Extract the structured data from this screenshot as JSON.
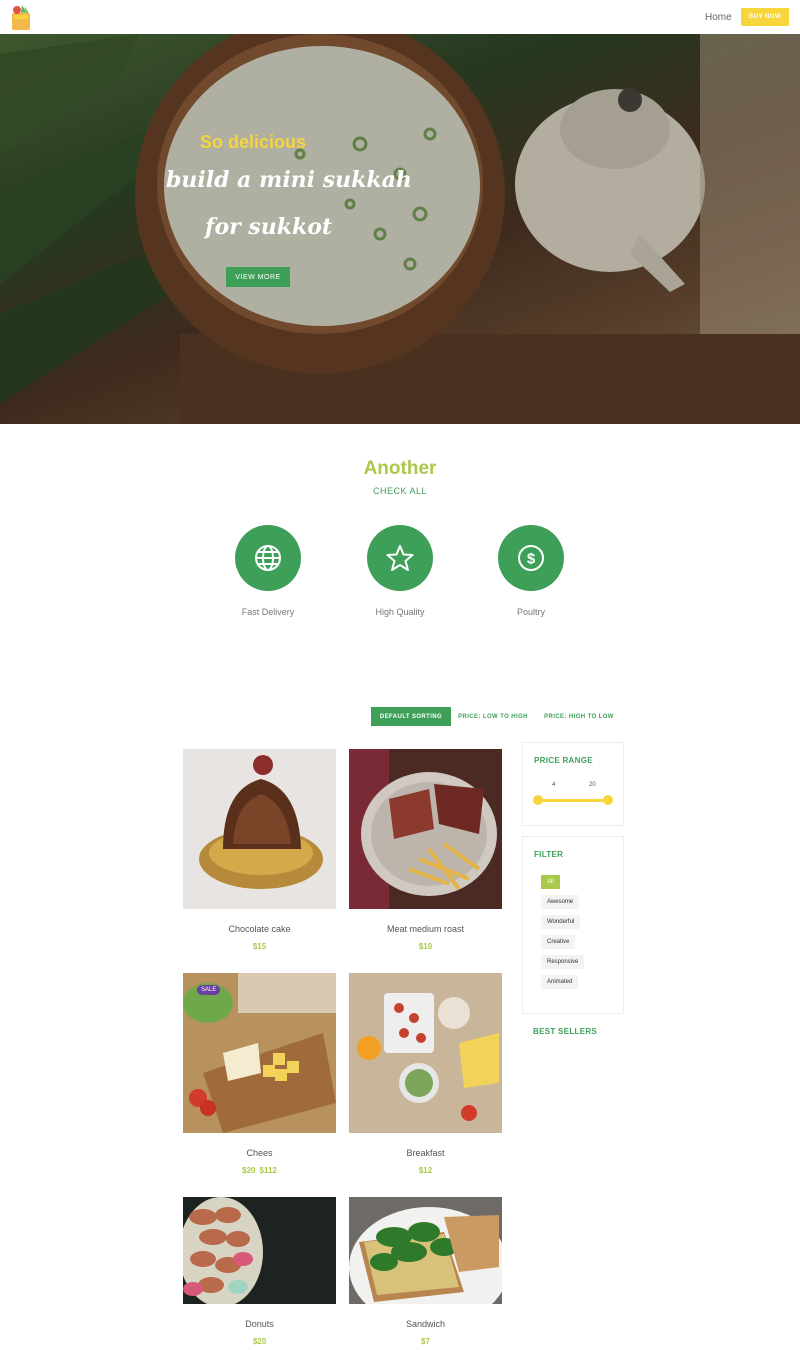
{
  "header": {
    "nav_home": "Home",
    "buy_label": "BUY NOW"
  },
  "hero": {
    "kicker": "So delicious",
    "line1": "build a mini sukkah",
    "line2": "for sukkot",
    "button": "VIEW MORE"
  },
  "features": {
    "title": "Another",
    "subtitle": "CHECK ALL",
    "items": [
      {
        "label": "Fast Delivery",
        "icon": "globe-icon"
      },
      {
        "label": "High Quality",
        "icon": "star-icon"
      },
      {
        "label": "Poultry",
        "icon": "dollar-icon"
      }
    ]
  },
  "sorting": {
    "default": "DEFAULT SORTING",
    "low_high": "PRICE: LOW TO HIGH",
    "high_low": "PRICE: HIGH TO LOW"
  },
  "products": [
    {
      "name": "Chocolate cake",
      "price": "$15"
    },
    {
      "name": "Meat medium roast",
      "price": "$10"
    },
    {
      "name": "Chees",
      "price": "$20",
      "old_price": "$112",
      "badge": "SALE"
    },
    {
      "name": "Breakfast",
      "price": "$12"
    },
    {
      "name": "Donuts",
      "price": "$20"
    },
    {
      "name": "Sandwich",
      "price": "$7"
    }
  ],
  "sidebar": {
    "price_range_title": "PRICE RANGE",
    "range_min": "4",
    "range_max": "20",
    "filter_title": "FILTER",
    "tags": [
      "All",
      "Awesome",
      "Wonderful",
      "Creative",
      "Responsive",
      "Animated"
    ],
    "best_sellers": "BEST SELLERS"
  },
  "colors": {
    "accent_green": "#3e9f58",
    "lime": "#a9c94a",
    "yellow": "#f7d53c",
    "sale_purple": "#6b3fa0"
  }
}
